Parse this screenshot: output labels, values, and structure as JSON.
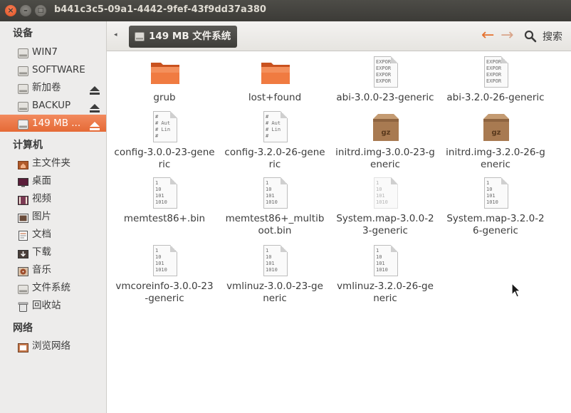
{
  "window": {
    "title": "b441c3c5-09a1-4442-9fef-43f9dd37a380"
  },
  "sidebar": {
    "devices_title": "设备",
    "devices": [
      {
        "label": "WIN7",
        "eject": false
      },
      {
        "label": "SOFTWARE",
        "eject": false
      },
      {
        "label": "新加卷",
        "eject": true
      },
      {
        "label": "BACKUP",
        "eject": true
      },
      {
        "label": "149 MB ...",
        "eject": true,
        "active": true
      }
    ],
    "computer_title": "计算机",
    "computer": [
      {
        "label": "主文件夹",
        "icon": "home-folder-icon"
      },
      {
        "label": "桌面",
        "icon": "desktop-icon"
      },
      {
        "label": "视频",
        "icon": "video-icon"
      },
      {
        "label": "图片",
        "icon": "picture-icon"
      },
      {
        "label": "文档",
        "icon": "document-icon"
      },
      {
        "label": "下载",
        "icon": "download-icon"
      },
      {
        "label": "音乐",
        "icon": "music-icon"
      },
      {
        "label": "文件系统",
        "icon": "filesystem-icon"
      },
      {
        "label": "回收站",
        "icon": "trash-icon"
      }
    ],
    "network_title": "网络",
    "network": [
      {
        "label": "浏览网络",
        "icon": "network-icon"
      }
    ]
  },
  "toolbar": {
    "path_label": "149 MB 文件系统",
    "search_label": "搜索"
  },
  "files": [
    {
      "name": "grub",
      "type": "folder"
    },
    {
      "name": "lost+found",
      "type": "folder"
    },
    {
      "name": "abi-3.0.0-23-generic",
      "type": "export"
    },
    {
      "name": "abi-3.2.0-26-generic",
      "type": "export"
    },
    {
      "name": "config-3.0.0-23-generic",
      "type": "config"
    },
    {
      "name": "config-3.2.0-26-generic",
      "type": "config"
    },
    {
      "name": "initrd.img-3.0.0-23-generic",
      "type": "archive"
    },
    {
      "name": "initrd.img-3.2.0-26-generic",
      "type": "archive"
    },
    {
      "name": "memtest86+.bin",
      "type": "binary"
    },
    {
      "name": "memtest86+_multiboot.bin",
      "type": "binary"
    },
    {
      "name": "System.map-3.0.0-23-generic",
      "type": "binary-light"
    },
    {
      "name": "System.map-3.2.0-26-generic",
      "type": "binary"
    },
    {
      "name": "vmcoreinfo-3.0.0-23-generic",
      "type": "binary"
    },
    {
      "name": "vmlinuz-3.0.0-23-generic",
      "type": "binary"
    },
    {
      "name": "vmlinuz-3.2.0-26-generic",
      "type": "binary"
    }
  ],
  "colors": {
    "accent": "#e96b38",
    "folder": "#ef6c35",
    "titlebar": "#3c3b37"
  }
}
